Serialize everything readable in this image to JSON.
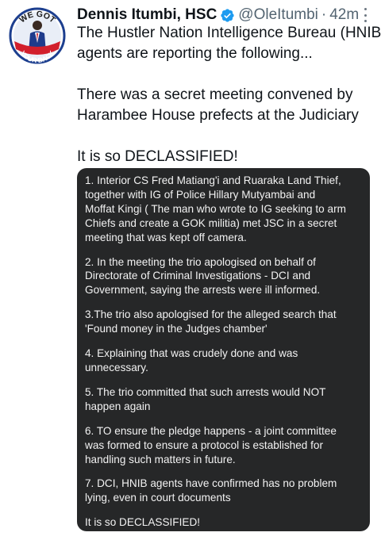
{
  "tweet": {
    "author": {
      "name": "Dennis Itumbi, HSC",
      "handle": "@OleItumbi",
      "separator": "·",
      "time": "42m",
      "avatar_text_top": "WE GOT",
      "avatar_text_bottom": "YOUR BACK"
    },
    "icons": {
      "verified": "verified-badge-icon",
      "more": "more-options-icon"
    },
    "colors": {
      "verified": "#1d9bf0",
      "avatar_ring": "#1d3f8f",
      "avatar_banner": "#d21f2c",
      "media_background": "#262728"
    },
    "text": {
      "p1_l1": "The Hustler Nation Intelligence Bureau (HNIB)",
      "p1_l2": "agents are reporting the following...",
      "p2_l1": "There was a secret meeting convened by",
      "p2_l2": "Harambee House prefects at the Judiciary",
      "p3_l1": "It is so DECLASSIFIED!"
    },
    "image_text": {
      "i1_l1": "1. Interior CS Fred Matiang'i and Ruaraka Land Thief,",
      "i1_l2": "together with IG of Police Hillary Mutyambai and",
      "i1_l3": "Moffat Kingi ( The man who wrote to IG seeking to arm",
      "i1_l4": "Chiefs and create a GOK militia) met JSC in a secret",
      "i1_l5": "meeting that was kept off camera.",
      "i2_l1": "2. In the meeting the trio apologised on behalf of",
      "i2_l2": "Directorate of Criminal Investigations - DCI and",
      "i2_l3": "Government, saying the arrests were ill informed.",
      "i3_l1": "3.The trio also apologised for the alleged search that",
      "i3_l2": "'Found money in the Judges chamber'",
      "i4_l1": "4. Explaining that was crudely done and was",
      "i4_l2": "unnecessary.",
      "i5_l1": "5. The trio committed that such arrests would NOT",
      "i5_l2": "happen again",
      "i6_l1": "6. TO ensure the pledge happens - a joint committee",
      "i6_l2": "was formed to ensure a protocol is established for",
      "i6_l3": "handling such matters in future.",
      "i7_l1": "7. DCI, HNIB agents have confirmed has no problem",
      "i7_l2": "lying, even in court documents",
      "closing": "It is so DECLASSIFIED!"
    }
  }
}
